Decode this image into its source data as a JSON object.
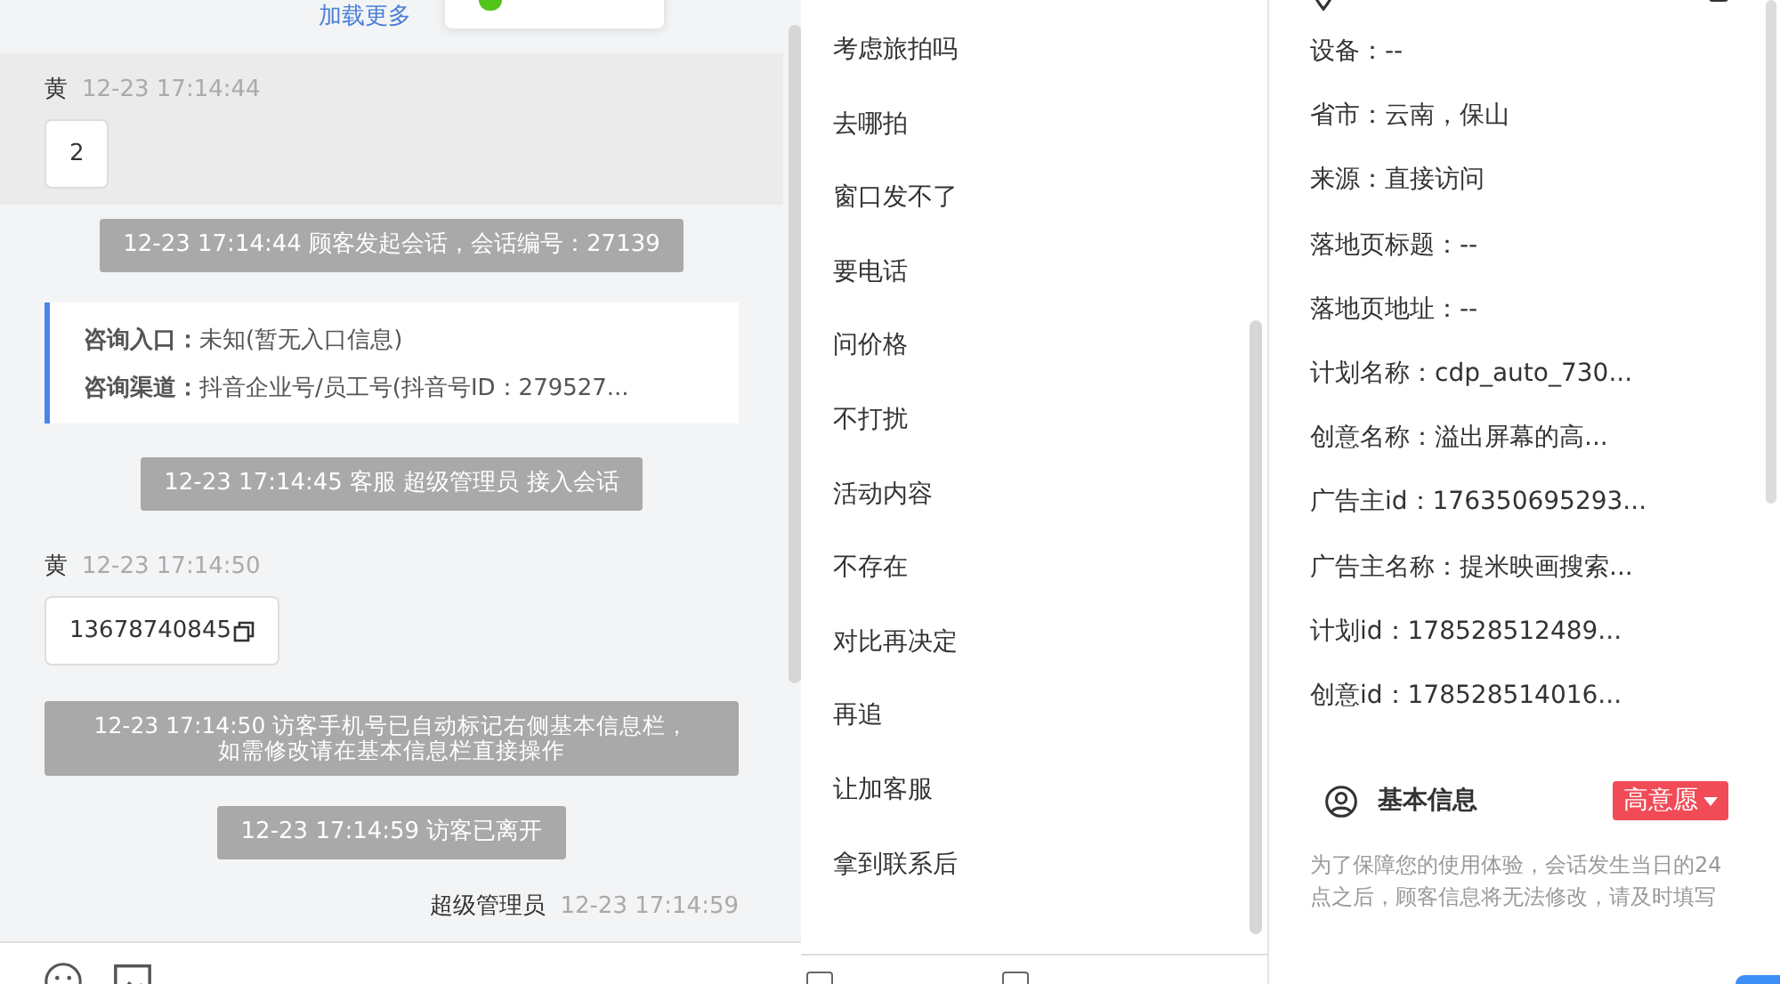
{
  "chat": {
    "load_more": "加载更多",
    "toast": {
      "kind": "success"
    },
    "messages": [
      {
        "kind": "visitor",
        "sender": "黄",
        "time": "12-23 17:14:44",
        "text": "2",
        "highlighted": true,
        "copyable": false
      },
      {
        "kind": "system",
        "text": "12-23 17:14:44 顾客发起会话，会话编号：27139",
        "wide": false
      },
      {
        "kind": "entry_card",
        "rows": [
          "**咨询入口：**未知(暂无入口信息)",
          "**咨询渠道：**抖音企业号/员工号(抖音号ID：279527..."
        ]
      },
      {
        "kind": "system",
        "text": "12-23 17:14:45 客服 超级管理员 接入会话",
        "wide": false
      },
      {
        "kind": "visitor",
        "sender": "黄",
        "time": "12-23 17:14:50",
        "text": "13678740845",
        "highlighted": false,
        "copyable": true
      },
      {
        "kind": "system",
        "lines": [
          "12-23 17:14:50 访客手机号已自动标记右侧基本信息栏，",
          "如需修改请在基本信息栏直接操作"
        ],
        "wide": true
      },
      {
        "kind": "system",
        "text": "12-23 17:14:59 访客已离开",
        "wide": false
      },
      {
        "kind": "agent",
        "sender": "超级管理员",
        "time": "12-23 17:14:59"
      }
    ]
  },
  "bottom_options": [
    {
      "checked": false
    },
    {
      "checked": false
    }
  ],
  "quick_replies": [
    "考虑旅拍吗",
    "去哪拍",
    "窗口发不了",
    "要电话",
    "问价格",
    "不打扰",
    "活动内容",
    "不存在",
    "对比再决定",
    "再追",
    "让加客服",
    "拿到联系后"
  ],
  "source_info": {
    "fields": [
      "设备：--",
      "省市：云南，保山",
      "来源：直接访问",
      "落地页标题：--",
      "落地页地址：--",
      "计划名称：cdp_auto_730...",
      "创意名称：溢出屏幕的高...",
      "广告主id：176350695293...",
      "广告主名称：提米映画搜索...",
      "计划id：178528512489...",
      "创意id：178528514016..."
    ]
  },
  "basic_info": {
    "title": "基本信息",
    "intent_tag": {
      "label": "高意愿",
      "color": "#f04b57"
    },
    "note": "为了保障您的使用体验，会话发生当日的24点之后，顾客信息将无法修改，请及时填写"
  }
}
